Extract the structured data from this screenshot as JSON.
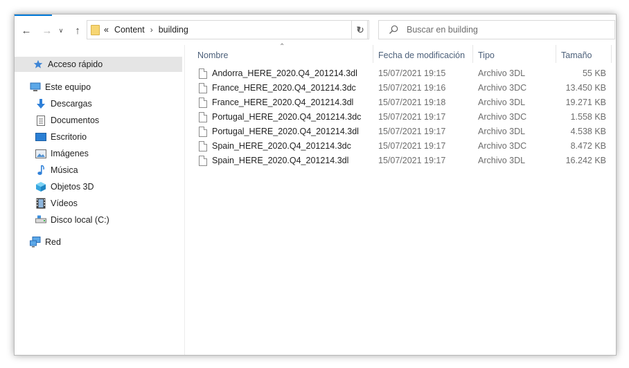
{
  "toolbar": {
    "breadcrumb": {
      "overflow": "«",
      "parts": [
        "Content",
        "building"
      ],
      "separator": "›"
    },
    "search_placeholder": "Buscar en building"
  },
  "sidebar": {
    "items": [
      {
        "label": "Acceso rápido",
        "icon": "star-icon"
      },
      {
        "label": "Este equipo",
        "icon": "computer-icon"
      },
      {
        "label": "Descargas",
        "icon": "download-arrow-icon"
      },
      {
        "label": "Documentos",
        "icon": "document-icon"
      },
      {
        "label": "Escritorio",
        "icon": "desktop-icon"
      },
      {
        "label": "Imágenes",
        "icon": "pictures-icon"
      },
      {
        "label": "Música",
        "icon": "music-note-icon"
      },
      {
        "label": "Objetos 3D",
        "icon": "cube-icon"
      },
      {
        "label": "Vídeos",
        "icon": "film-icon"
      },
      {
        "label": "Disco local (C:)",
        "icon": "drive-icon"
      },
      {
        "label": "Red",
        "icon": "network-icon"
      }
    ]
  },
  "columns": {
    "name": "Nombre",
    "date": "Fecha de modificación",
    "type": "Tipo",
    "size": "Tamaño"
  },
  "files": [
    {
      "name": "Andorra_HERE_2020.Q4_201214.3dl",
      "date": "15/07/2021 19:15",
      "type": "Archivo 3DL",
      "size": "55 KB"
    },
    {
      "name": "France_HERE_2020.Q4_201214.3dc",
      "date": "15/07/2021 19:16",
      "type": "Archivo 3DC",
      "size": "13.450 KB"
    },
    {
      "name": "France_HERE_2020.Q4_201214.3dl",
      "date": "15/07/2021 19:18",
      "type": "Archivo 3DL",
      "size": "19.271 KB"
    },
    {
      "name": "Portugal_HERE_2020.Q4_201214.3dc",
      "date": "15/07/2021 19:17",
      "type": "Archivo 3DC",
      "size": "1.558 KB"
    },
    {
      "name": "Portugal_HERE_2020.Q4_201214.3dl",
      "date": "15/07/2021 19:17",
      "type": "Archivo 3DL",
      "size": "4.538 KB"
    },
    {
      "name": "Spain_HERE_2020.Q4_201214.3dc",
      "date": "15/07/2021 19:17",
      "type": "Archivo 3DC",
      "size": "8.472 KB"
    },
    {
      "name": "Spain_HERE_2020.Q4_201214.3dl",
      "date": "15/07/2021 19:17",
      "type": "Archivo 3DL",
      "size": "16.242 KB"
    }
  ]
}
